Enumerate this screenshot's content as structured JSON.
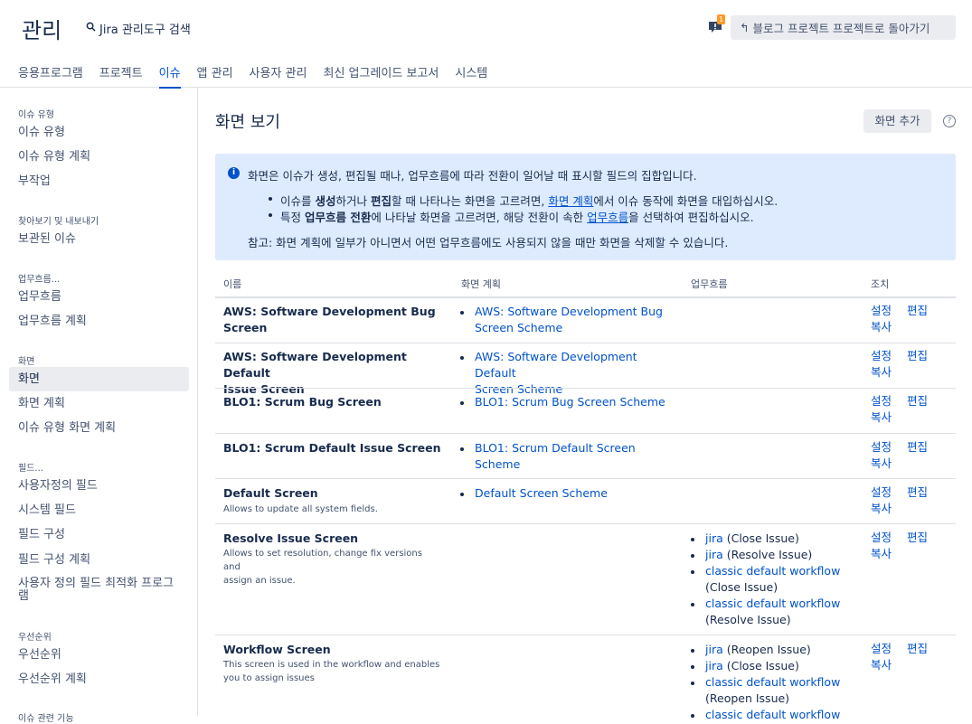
{
  "app_title": "관리",
  "search": {
    "placeholder": "Jira 관리도구 검색"
  },
  "notification": {
    "count": "1"
  },
  "back_button": {
    "label": "블로그 프로젝트 프로젝트로 돌아가기"
  },
  "tabs": [
    "응용프로그램",
    "프로젝트",
    "이슈",
    "앱 관리",
    "사용자 관리",
    "최신 업그레이드 보고서",
    "시스템"
  ],
  "active_tab": "이슈",
  "sidebar": {
    "sections": [
      {
        "heading": "이슈 유형",
        "items": [
          "이슈 유형",
          "이슈 유형 계획",
          "부작업"
        ]
      },
      {
        "heading": "찾아보기 및 내보내기",
        "items": [
          "보관된 이슈"
        ]
      },
      {
        "heading": "업무흐름...",
        "items": [
          "업무흐름",
          "업무흐름 계획"
        ]
      },
      {
        "heading": "화면",
        "items": [
          "화면",
          "화면 계획",
          "이슈 유형 화면 계획"
        ]
      },
      {
        "heading": "필드...",
        "items": [
          "사용자정의 필드",
          "시스템 필드",
          "필드 구성",
          "필드 구성 계획",
          "사용자 정의 필드 최적화 프로그램"
        ]
      },
      {
        "heading": "우선순위",
        "items": [
          "우선순위",
          "우선순위 계획"
        ]
      },
      {
        "heading": "이슈 관련 기능",
        "items": []
      }
    ],
    "active_item": "화면"
  },
  "main": {
    "title": "화면 보기",
    "add_button": "화면 추가",
    "help_icon": "?"
  },
  "info": {
    "intro": "화면은 이슈가 생성, 편집될 때나, 업무흐름에 따라 전환이 일어날 때 표시할 필드의 집합입니다.",
    "b1_p1": "이슈를 ",
    "b1_bold1": "생성",
    "b1_p2": "하거나 ",
    "b1_bold2": "편집",
    "b1_p3": "할 때 나타나는 화면을 고르려면, ",
    "b1_link": "화면 계획",
    "b1_p4": "에서 이슈 동작에 화면을 대입하십시오.",
    "b2_p1": "특정 ",
    "b2_bold": "업무흐름 전환",
    "b2_p2": "에 나타날 화면을 고르려면, 해당 전환이 속한 ",
    "b2_link": "업무흐름",
    "b2_p3": "을 선택하여 편집하십시오.",
    "note": "참고: 화면 계획에 일부가 아니면서 어떤 업무흐름에도 사용되지 않을 때만 화면을 삭제할 수 있습니다."
  },
  "table": {
    "headers": [
      "이름",
      "화면 계획",
      "업무흐름",
      "조치"
    ],
    "action_settings": "설정",
    "action_copy": "복사",
    "action_edit": "편집",
    "rows": [
      {
        "name": "AWS: Software Development Bug Screen",
        "desc": "",
        "scheme_l1": "AWS: Software Development Bug",
        "scheme_l2": "Screen Scheme"
      },
      {
        "name": "AWS: Software Development Default",
        "name_l2": "Issue Screen",
        "desc": "",
        "scheme_l1": "AWS: Software Development Default",
        "scheme_l2": "Screen Scheme"
      },
      {
        "name": "BLO1: Scrum Bug Screen",
        "desc": "",
        "scheme_l1": "BLO1: Scrum Bug Screen Scheme",
        "scheme_l2": ""
      },
      {
        "name": "BLO1: Scrum Default Issue Screen",
        "desc": "",
        "scheme_l1": "BLO1: Scrum Default Screen Scheme",
        "scheme_l2": ""
      },
      {
        "name": "Default Screen",
        "desc": "Allows to update all system fields.",
        "scheme_l1": "Default Screen Scheme",
        "scheme_l2": ""
      },
      {
        "name": "Resolve Issue Screen",
        "desc_l1": "Allows to set resolution, change fix versions and",
        "desc_l2": "assign an issue.",
        "workflows": [
          {
            "name": "jira",
            "step": " (Close Issue)"
          },
          {
            "name": "jira",
            "step": " (Resolve Issue)"
          },
          {
            "name": "classic default workflow",
            "step": "(Close Issue)"
          },
          {
            "name": "classic default workflow",
            "step": "(Resolve Issue)"
          }
        ]
      },
      {
        "name": "Workflow Screen",
        "desc_l1": "This screen is used in the workflow and enables",
        "desc_l2": "you to assign issues",
        "workflows": [
          {
            "name": "jira",
            "step": " (Reopen Issue)"
          },
          {
            "name": "jira",
            "step": " (Close Issue)"
          },
          {
            "name": "classic default workflow",
            "step": "(Reopen Issue)"
          },
          {
            "name": "classic default workflow",
            "step": ""
          }
        ]
      }
    ]
  },
  "colors": {
    "accent": "#0052cc",
    "info_bg": "#deebff",
    "button_bg": "#ebecf0",
    "badge": "#ff991f"
  }
}
